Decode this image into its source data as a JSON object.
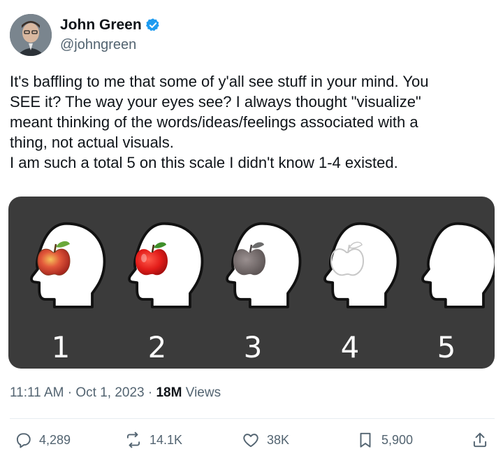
{
  "author": {
    "display_name": "John Green",
    "handle": "@johngreen",
    "verified": true,
    "avatar_icon": "profile-photo"
  },
  "tweet": {
    "lines": [
      "It's baffling to me that some of y'all see stuff in your mind. You",
      "SEE it? The way your eyes see? I always thought \"visualize\"",
      "meant thinking of the words/ideas/feelings associated with a",
      "thing, not actual visuals.",
      "I am such a total 5 on this scale I didn't know 1-4 existed."
    ]
  },
  "media": {
    "scale_labels": [
      "1",
      "2",
      "3",
      "4",
      "5"
    ],
    "background_color": "#3b3b3b"
  },
  "meta": {
    "time": "11:11 AM",
    "date": "Oct 1, 2023",
    "views_count": "18M",
    "views_label": "Views"
  },
  "actions": {
    "replies": "4,289",
    "reposts": "14.1K",
    "likes": "38K",
    "bookmarks": "5,900"
  },
  "colors": {
    "verified_blue": "#1d9bf0",
    "secondary_text": "#536471",
    "primary_text": "#0f1419"
  }
}
